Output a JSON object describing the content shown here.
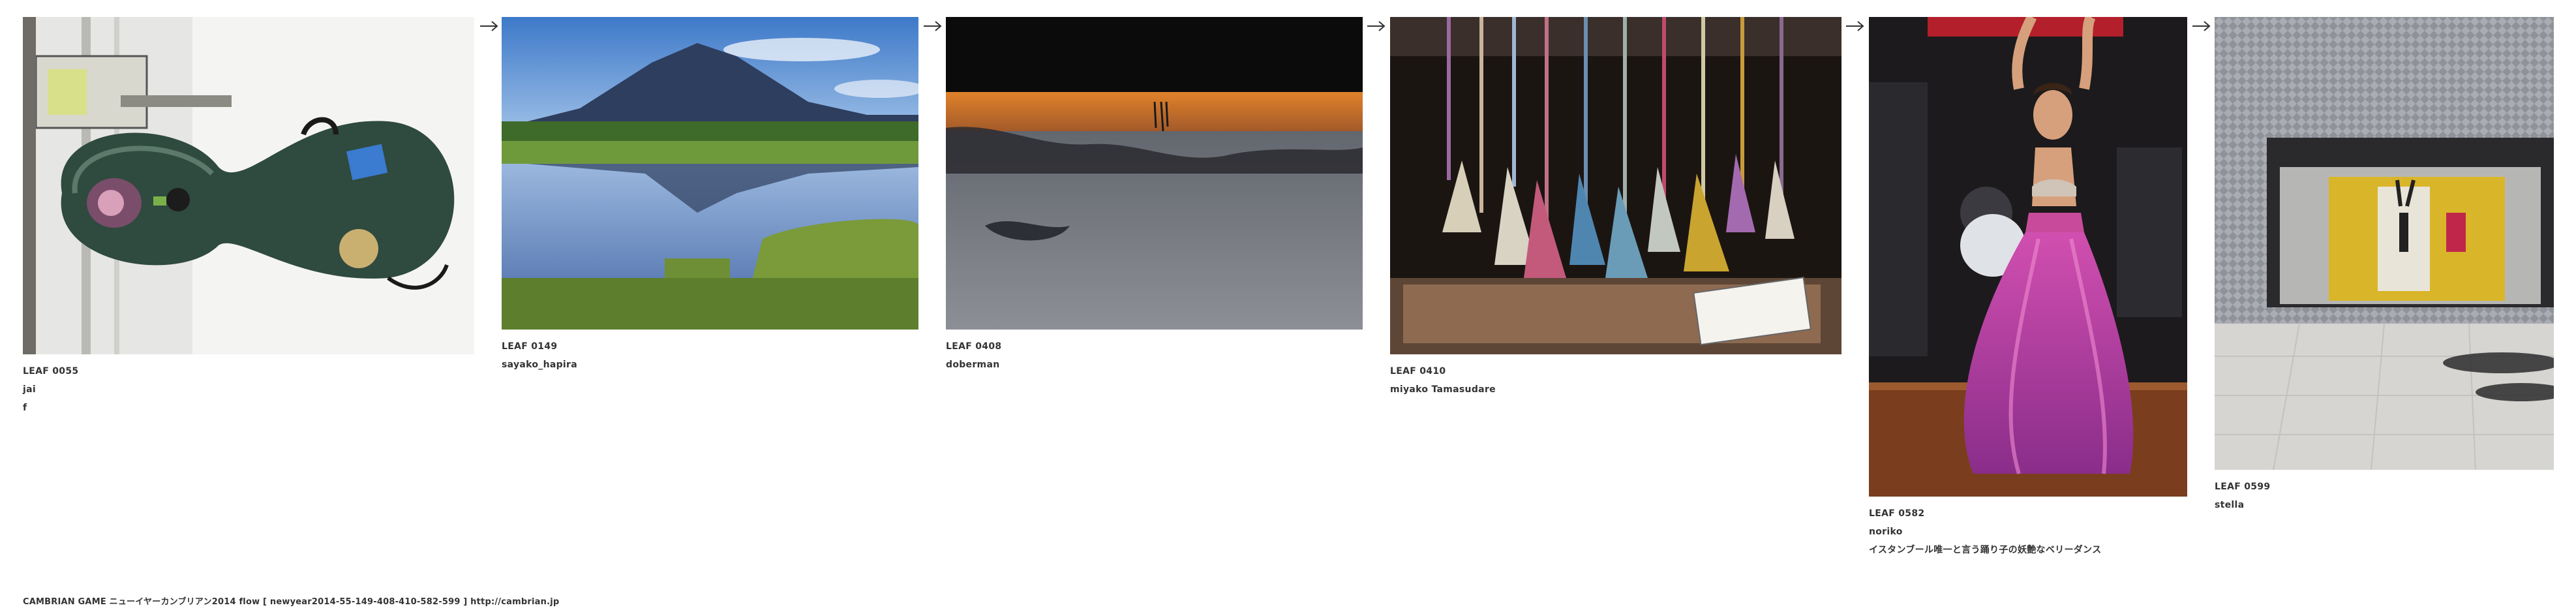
{
  "leaves": [
    {
      "id": "LEAF 0055",
      "author": "jai",
      "note": "f",
      "image": "cello case with stickers leaning by a road"
    },
    {
      "id": "LEAF 0149",
      "author": "sayako_hapira",
      "note": "",
      "image": "mountain reflected in a marsh pond"
    },
    {
      "id": "LEAF 0408",
      "author": "doberman",
      "note": "",
      "image": "upside-down sunset reflection on water"
    },
    {
      "id": "LEAF 0410",
      "author": "miyako Tamasudare",
      "note": "",
      "image": "hanging silk tassels for sale with price tag"
    },
    {
      "id": "LEAF 0582",
      "author": "noriko",
      "note": "イスタンブール唯一と言う踊り子の妖艶なベリーダンス",
      "image": "belly dancer in pink skirt on stage"
    },
    {
      "id": "LEAF 0599",
      "author": "stella",
      "note": "",
      "image": "storefront window with shadows on pavement"
    }
  ],
  "footer": {
    "text": "CAMBRIAN GAME  ニューイヤーカンブリアン2014  flow [ newyear2014-55-149-408-410-582-599 ]    http://cambrian.jp"
  },
  "icons": {
    "flow_arrow": "right-arrow-icon"
  }
}
